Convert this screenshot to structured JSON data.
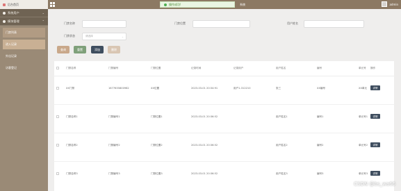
{
  "sidebar": {
    "logo_text": "后台首页",
    "groups": [
      {
        "label": "系统用户",
        "chevron": "⌄"
      },
      {
        "label": "模块管理",
        "chevron": "⌃"
      }
    ],
    "items": [
      {
        "label": "门禁列表"
      },
      {
        "label": "进入记录"
      },
      {
        "label": "外出记录"
      },
      {
        "label": "访客登记"
      }
    ]
  },
  "topbar": {
    "toast": "操作成功!",
    "center_text": "系统",
    "username": "admin"
  },
  "filters": {
    "door_name_label": "门禁名称",
    "door_position_label": "门禁位置",
    "user_name_label": "用户姓名",
    "door_status_label": "门禁状态",
    "door_status_placeholder": "请选择"
  },
  "buttons": {
    "search": "查询",
    "reset": "重置",
    "add": "添加",
    "delete": "删除"
  },
  "colors": {
    "sidebar_bg": "#9a8a76",
    "topbar_bg": "#8c7963",
    "search_btn": "#c9a88a",
    "reset_btn": "#7fa07a",
    "add_btn": "#3f4e5f",
    "delete_btn": "#d9c6b3"
  },
  "table": {
    "headers": [
      "门禁名称",
      "门禁编号",
      "门禁位置",
      "记录时间",
      "记录用户",
      "用户姓名",
      "编号",
      "单元号",
      "操作"
    ],
    "rows": [
      {
        "name": "XX门禁",
        "code": "1677635800982",
        "position": "XX位置",
        "time": "2023-03-01 20:34:91",
        "user": "用户1-312210",
        "user_name": "张三",
        "number": "XX编号",
        "unit": "XX单元",
        "action": "详情"
      },
      {
        "name": "门禁名称1",
        "code": "门禁编号1",
        "position": "门禁位置1",
        "time": "2023-03-01 20:36:52",
        "user": "",
        "user_name": "用户姓名1",
        "number": "编号1",
        "unit": "单元号1",
        "action": "详情"
      },
      {
        "name": "门禁名称2",
        "code": "门禁编号2",
        "position": "门禁位置2",
        "time": "2023-03-01 20:36:52",
        "user": "",
        "user_name": "用户姓名2",
        "number": "编号2",
        "unit": "单元号2",
        "action": "详情"
      },
      {
        "name": "门禁名称3",
        "code": "门禁编号3",
        "position": "门禁位置3",
        "time": "2023-03-01 20:36:52",
        "user": "",
        "user_name": "用户姓名3",
        "number": "编号3",
        "unit": "单元号3",
        "action": "详情"
      }
    ]
  },
  "watermark": "CSDN @bs_wa66"
}
